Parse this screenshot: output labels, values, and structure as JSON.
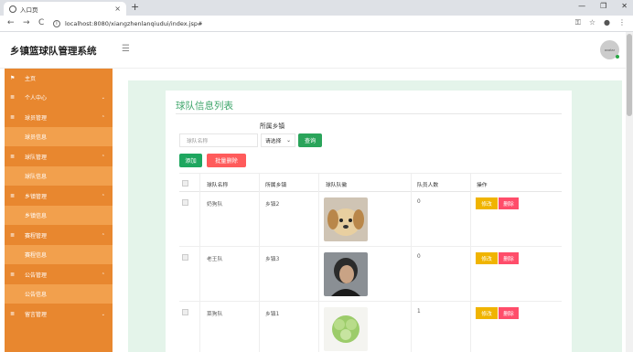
{
  "browser": {
    "tab_title": "入口页",
    "url": "localhost:8080/xiangzhenlanqiudui/index.jsp#"
  },
  "app": {
    "brand": "乡镇篮球队管理系统",
    "avatar_text": "avatar"
  },
  "sidebar": {
    "items": [
      {
        "label": "主页",
        "type": "group",
        "icon": "flag-icon"
      },
      {
        "label": "个人中心",
        "type": "group",
        "icon": "list-icon"
      },
      {
        "label": "球员管理",
        "type": "group",
        "icon": "list-icon"
      },
      {
        "label": "球员信息",
        "type": "sub"
      },
      {
        "label": "球队管理",
        "type": "group",
        "icon": "list-icon"
      },
      {
        "label": "球队信息",
        "type": "sub"
      },
      {
        "label": "乡镇管理",
        "type": "group",
        "icon": "list-icon"
      },
      {
        "label": "乡镇信息",
        "type": "sub"
      },
      {
        "label": "赛程管理",
        "type": "group",
        "icon": "list-icon"
      },
      {
        "label": "赛程信息",
        "type": "sub"
      },
      {
        "label": "公告管理",
        "type": "group",
        "icon": "list-icon"
      },
      {
        "label": "公告信息",
        "type": "sub"
      },
      {
        "label": "留言管理",
        "type": "group",
        "icon": "list-icon"
      }
    ]
  },
  "main": {
    "title": "球队信息列表",
    "filter_town_label": "所属乡镇",
    "name_placeholder": "球队名称",
    "town_select_value": "请选择",
    "query_button": "查询",
    "add_button": "添加",
    "batch_delete_button": "批量删除",
    "columns": [
      "球队名称",
      "所属乡镇",
      "球队队徽",
      "队员人数",
      "操作"
    ],
    "rows": [
      {
        "name": "奶狗队",
        "town": "乡镇2",
        "logo": "puppy",
        "members": "0"
      },
      {
        "name": "老王队",
        "town": "乡镇3",
        "logo": "person",
        "members": "0"
      },
      {
        "name": "菜狗队",
        "town": "乡镇1",
        "logo": "cabbage",
        "members": "1"
      }
    ],
    "edit_label": "修改",
    "delete_label": "删除"
  },
  "colors": {
    "sidebar": "#e8872f",
    "sidebar_sub": "#f2a04d",
    "accent_green": "#3fa66b",
    "edit_yellow": "#f0b400",
    "delete_red": "#ff4d6a"
  }
}
